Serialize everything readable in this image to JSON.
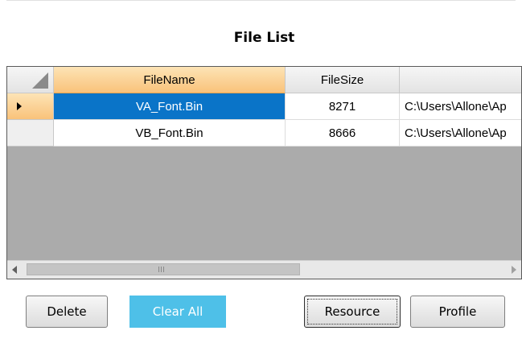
{
  "title": "File List",
  "grid": {
    "columns": [
      "FileName",
      "FileSize",
      ""
    ],
    "rows": [
      {
        "file_name": "VA_Font.Bin",
        "file_size": "8271",
        "path": "C:\\Users\\Allone\\Ap",
        "selected": true
      },
      {
        "file_name": "VB_Font.Bin",
        "file_size": "8666",
        "path": "C:\\Users\\Allone\\Ap",
        "selected": false
      }
    ]
  },
  "buttons": {
    "delete": "Delete",
    "clear_all": "Clear All",
    "resource": "Resource",
    "profile": "Profile"
  },
  "colors": {
    "selection": "#0a74c8",
    "clear_all_bg": "#4ec0e8",
    "header_active": "#f9c27a",
    "empty_area": "#ababab"
  }
}
